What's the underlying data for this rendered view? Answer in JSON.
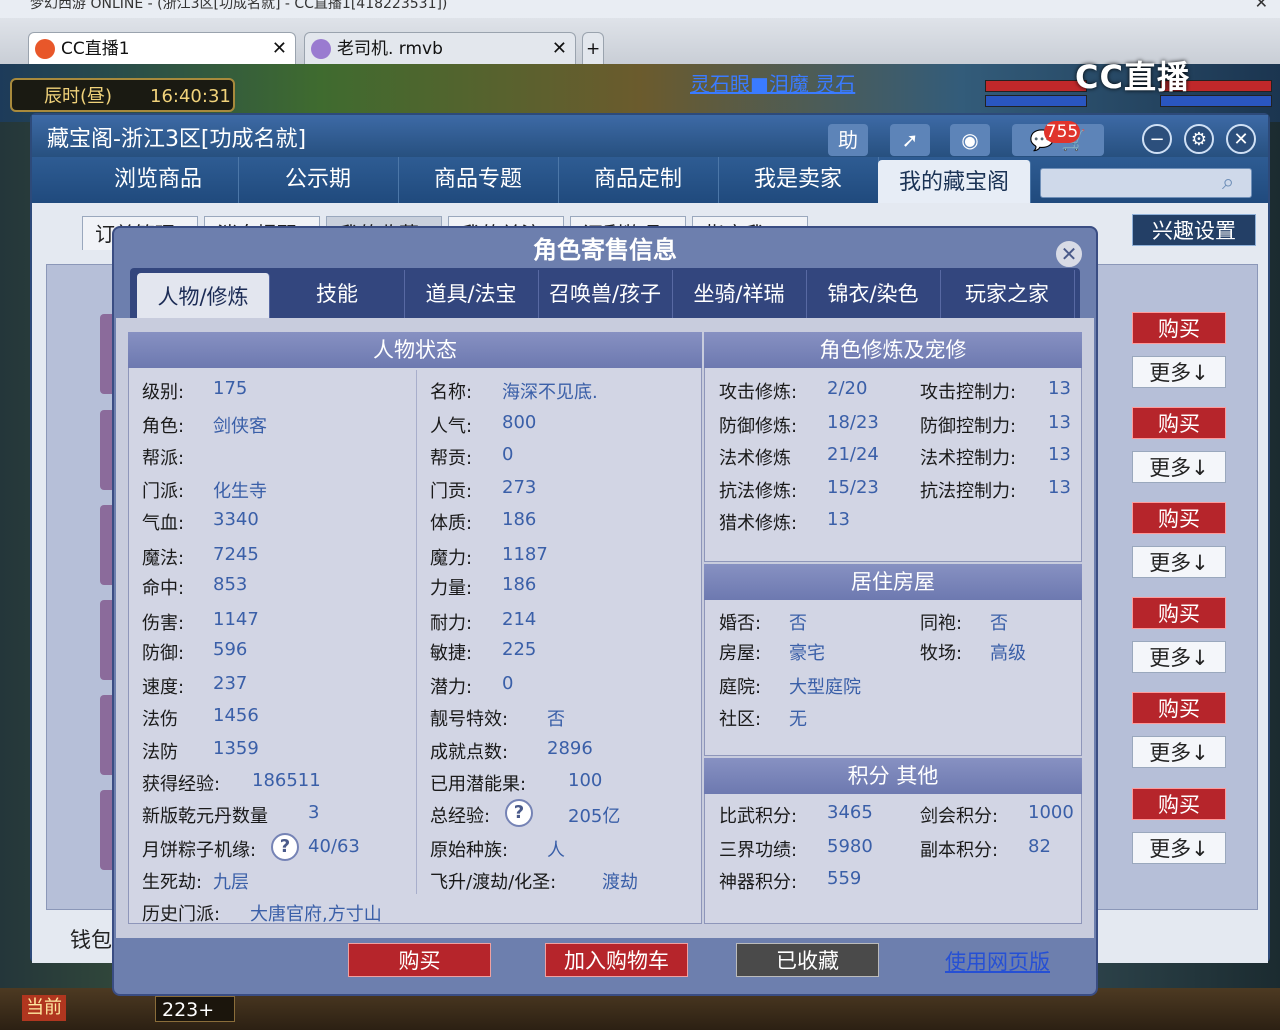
{
  "os_title": "梦幻西游 ONLINE - (浙江3区[功成名就] - CC直播1[418223531])",
  "browser_tabs": [
    {
      "label": "CC直播1"
    },
    {
      "label": "老司机. rmvb"
    }
  ],
  "game": {
    "period": "辰时(昼)",
    "time": "16:40:31",
    "chat_snippet": "灵石眼■泪魔 灵石",
    "stream_logo": "CC直播",
    "bottom_now": "当前",
    "bottom_count": "223+"
  },
  "window": {
    "title": "藏宝阁-浙江3区[功成名就]",
    "help_label": "助",
    "badge_count": "755",
    "nav": [
      "浏览商品",
      "公示期",
      "商品专题",
      "商品定制",
      "我是卖家",
      "我的藏宝阁"
    ],
    "active_nav": "我的藏宝阁",
    "sub_tabs": [
      "订单管理",
      "消息提醒",
      "我的收藏",
      "我的关注",
      "还剩物品",
      "指定我"
    ],
    "interest_button": "兴趣设置",
    "buy_label": "购买",
    "more_label": "更多↓",
    "wallet_label": "钱包"
  },
  "dialog": {
    "title": "角色寄售信息",
    "tabs": [
      "人物/修炼",
      "技能",
      "道具/法宝",
      "召唤兽/孩子",
      "坐骑/祥瑞",
      "锦衣/染色",
      "玩家之家"
    ],
    "active_tab": "人物/修炼",
    "status": {
      "header": "人物状态",
      "col1": [
        {
          "label": "级别:",
          "value": "175"
        },
        {
          "label": "角色:",
          "value": "剑侠客"
        },
        {
          "label": "帮派:",
          "value": ""
        },
        {
          "label": "门派:",
          "value": "化生寺"
        },
        {
          "label": "气血:",
          "value": "3340"
        },
        {
          "label": "魔法:",
          "value": "7245"
        },
        {
          "label": "命中:",
          "value": "853"
        },
        {
          "label": "伤害:",
          "value": "1147"
        },
        {
          "label": "防御:",
          "value": "596"
        },
        {
          "label": "速度:",
          "value": "237"
        },
        {
          "label": "法伤",
          "value": "1456"
        },
        {
          "label": "法防",
          "value": "1359"
        },
        {
          "label": "获得经验:",
          "value": "186511"
        },
        {
          "label": "新版乾元丹数量",
          "value": "3"
        },
        {
          "label": "月饼粽子机缘:",
          "value": "40/63"
        },
        {
          "label": "生死劫:",
          "value": "九层"
        }
      ],
      "col2": [
        {
          "label": "名称:",
          "value": "海深不见底."
        },
        {
          "label": "人气:",
          "value": "800"
        },
        {
          "label": "帮贡:",
          "value": "0"
        },
        {
          "label": "门贡:",
          "value": "273"
        },
        {
          "label": "体质:",
          "value": "186"
        },
        {
          "label": "魔力:",
          "value": "1187"
        },
        {
          "label": "力量:",
          "value": "186"
        },
        {
          "label": "耐力:",
          "value": "214"
        },
        {
          "label": "敏捷:",
          "value": "225"
        },
        {
          "label": "潜力:",
          "value": "0"
        },
        {
          "label": "靓号特效:",
          "value": "否"
        },
        {
          "label": "成就点数:",
          "value": "2896"
        },
        {
          "label": "已用潜能果:",
          "value": "100"
        },
        {
          "label": "总经验:",
          "value": "205亿"
        },
        {
          "label": "原始种族:",
          "value": "人"
        },
        {
          "label": "飞升/渡劫/化圣:",
          "value": "渡劫"
        }
      ],
      "history_label": "历史门派:",
      "history_value": "大唐官府,方寸山"
    },
    "cultivation": {
      "header": "角色修炼及宠修",
      "left": [
        {
          "label": "攻击修炼:",
          "value": "2/20"
        },
        {
          "label": "防御修炼:",
          "value": "18/23"
        },
        {
          "label": "法术修炼",
          "value": "21/24"
        },
        {
          "label": "抗法修炼:",
          "value": "15/23"
        },
        {
          "label": "猎术修炼:",
          "value": "13"
        }
      ],
      "right": [
        {
          "label": "攻击控制力:",
          "value": "13"
        },
        {
          "label": "防御控制力:",
          "value": "13"
        },
        {
          "label": "法术控制力:",
          "value": "13"
        },
        {
          "label": "抗法控制力:",
          "value": "13"
        }
      ]
    },
    "house": {
      "header": "居住房屋",
      "items": [
        {
          "label": "婚否:",
          "value": "否"
        },
        {
          "label": "同袍:",
          "value": "否"
        },
        {
          "label": "房屋:",
          "value": "豪宅"
        },
        {
          "label": "牧场:",
          "value": "高级"
        },
        {
          "label": "庭院:",
          "value": "大型庭院"
        },
        {
          "label": "社区:",
          "value": "无"
        }
      ]
    },
    "points": {
      "header": "积分 其他",
      "items": [
        {
          "label": "比武积分:",
          "value": "3465"
        },
        {
          "label": "剑会积分:",
          "value": "1000"
        },
        {
          "label": "三界功绩:",
          "value": "5980"
        },
        {
          "label": "副本积分:",
          "value": "82"
        },
        {
          "label": "神器积分:",
          "value": "559"
        }
      ]
    },
    "question_mark": "?",
    "buttons": {
      "buy": "购买",
      "add_cart": "加入购物车",
      "favorited": "已收藏",
      "web_version": "使用网页版"
    }
  },
  "colors": {
    "value_text": "#3a5fa8",
    "buy_red": "#b6252b",
    "nav_blue": "#27507f"
  }
}
